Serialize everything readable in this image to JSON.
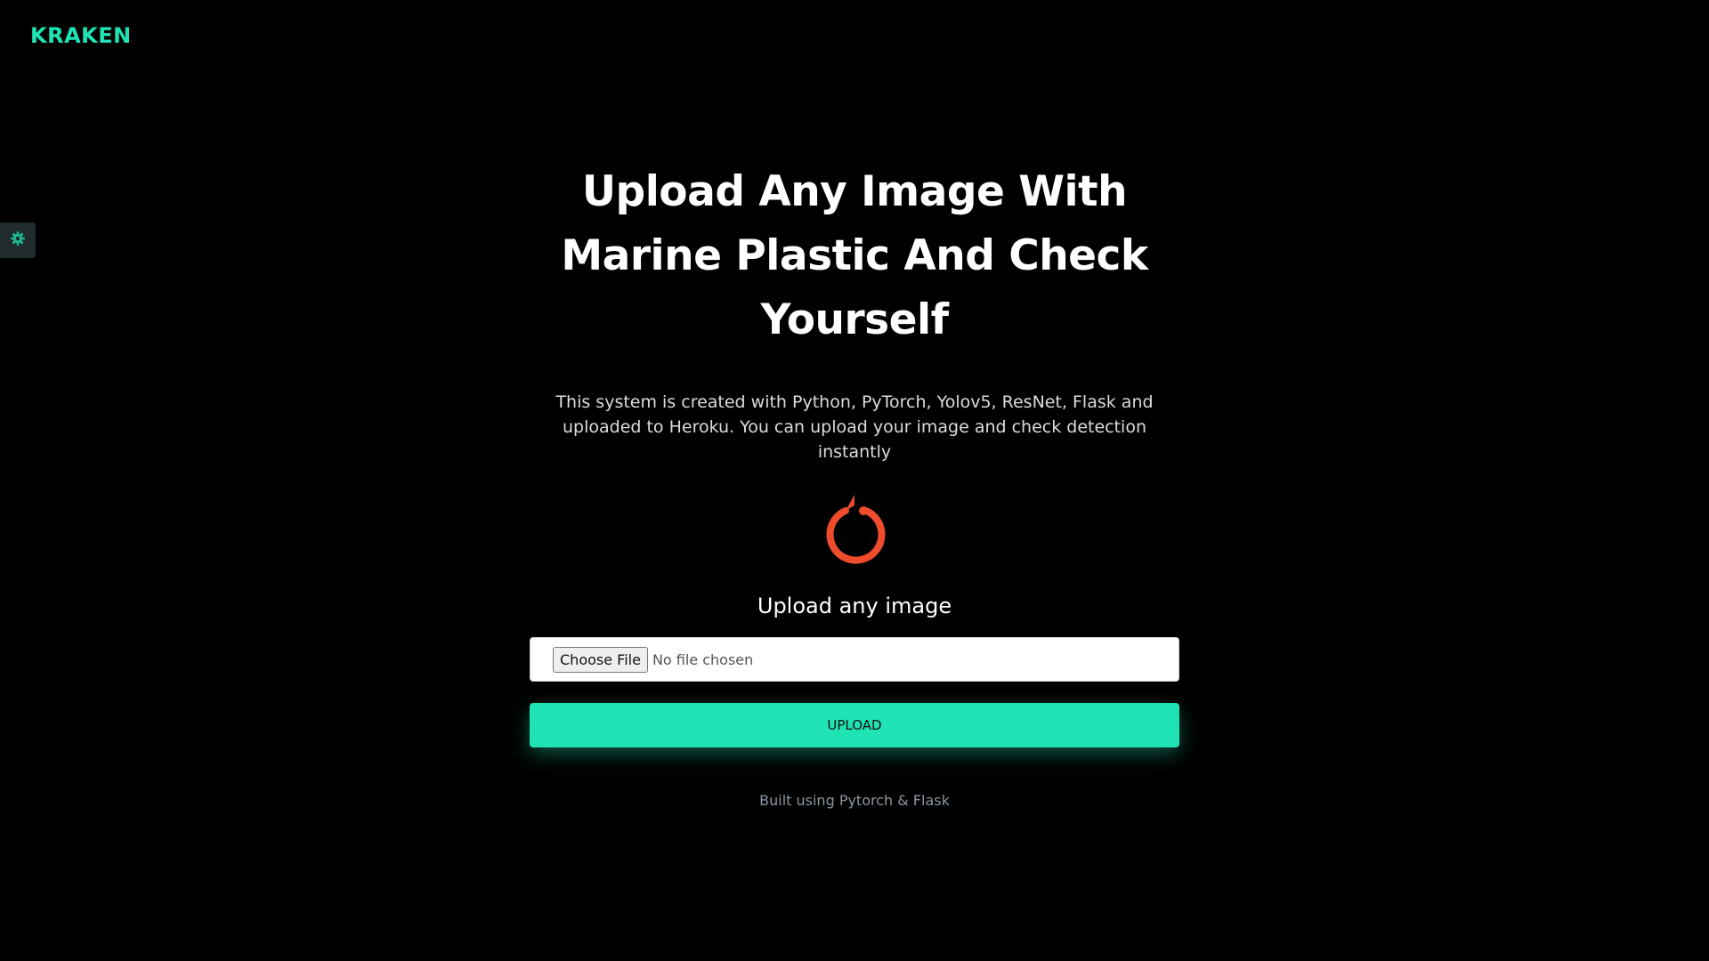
{
  "header": {
    "brand": "KRAKEN"
  },
  "sidebar": {
    "settings_icon": "gear-icon"
  },
  "main": {
    "title_lines": [
      "Upload Any Image With",
      "Marine Plastic And Check",
      "Yourself"
    ],
    "description_lines": [
      "This system is created with Python, PyTorch, Yolov5, ResNet, Flask and",
      "uploaded to Heroku. You can upload your image and check detection instantly"
    ],
    "logo_icon": "pytorch-logo-icon",
    "upload_label": "Upload any image",
    "file_input": {
      "button_label": "Choose File",
      "status": "No file chosen"
    },
    "upload_button": "UPLOAD",
    "footer_note": "Built using Pytorch & Flask"
  },
  "colors": {
    "background": "#000000",
    "accent": "#1fe3b4",
    "logo": "#ee4c2c",
    "settings_tab": "#1f2b2c"
  }
}
